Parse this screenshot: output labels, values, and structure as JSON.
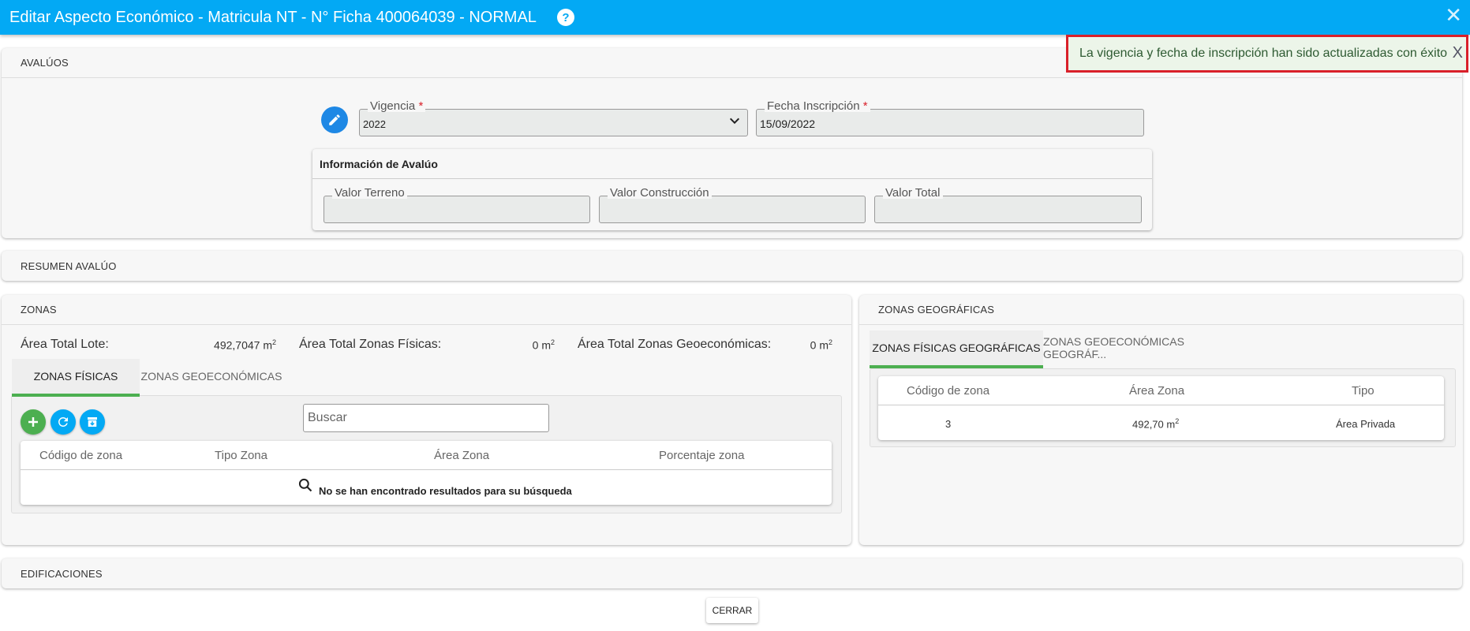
{
  "window": {
    "title": "Editar Aspecto Económico - Matricula NT - N° Ficha 400064039 - NORMAL",
    "help_icon": "question-icon",
    "close_label": "✕"
  },
  "toast": {
    "message": "La vigencia y fecha de inscripción han sido actualizadas con éxito",
    "close": "X"
  },
  "avaluos": {
    "header": "AVALÚOS",
    "vigencia": {
      "label": "Vigencia",
      "value": "2022"
    },
    "fecha": {
      "label": "Fecha Inscripción",
      "value": "15/09/2022"
    },
    "required_mark": "*",
    "info": {
      "title": "Información de Avalúo",
      "terreno": {
        "label": "Valor Terreno",
        "value": ""
      },
      "construccion": {
        "label": "Valor Construcción",
        "value": ""
      },
      "total": {
        "label": "Valor Total",
        "value": ""
      }
    }
  },
  "resumen": {
    "header": "RESUMEN AVALÚO"
  },
  "zonas": {
    "header": "ZONAS",
    "area_total_lote": {
      "label": "Área Total Lote:",
      "value": "492,7047 m",
      "unit_sup": "2"
    },
    "area_fisicas": {
      "label": "Área Total Zonas Físicas:",
      "value": "0 m",
      "unit_sup": "2"
    },
    "area_geoeconomicas": {
      "label": "Área Total Zonas Geoeconómicas:",
      "value": "0 m",
      "unit_sup": "2"
    },
    "tabs": [
      "ZONAS FÍSICAS",
      "ZONAS GEOECONÓMICAS"
    ],
    "search_placeholder": "Buscar",
    "columns": [
      "Código de zona",
      "Tipo Zona",
      "Área Zona",
      "Porcentaje zona"
    ],
    "empty_message": "No se han encontrado resultados para su búsqueda"
  },
  "zonas_geo": {
    "header": "ZONAS GEOGRÁFICAS",
    "tabs": [
      "ZONAS FÍSICAS GEOGRÁFICAS",
      "ZONAS GEOECONÓMICAS GEOGRÁF..."
    ],
    "columns": [
      "Código de zona",
      "Área Zona",
      "Tipo"
    ],
    "rows": [
      {
        "codigo": "3",
        "area": "492,70 m",
        "area_sup": "2",
        "tipo": "Área Privada"
      }
    ]
  },
  "edificaciones": {
    "header": "EDIFICACIONES"
  },
  "footer": {
    "cerrar_label": "CERRAR"
  },
  "colors": {
    "titlebar": "#03a9f4",
    "add": "#4caf50",
    "refresh": "#03a9f4",
    "archive": "#03a9f4",
    "edit": "#1e88e5",
    "active_tab": "#4caf50",
    "toast_border": "#d9202a"
  }
}
